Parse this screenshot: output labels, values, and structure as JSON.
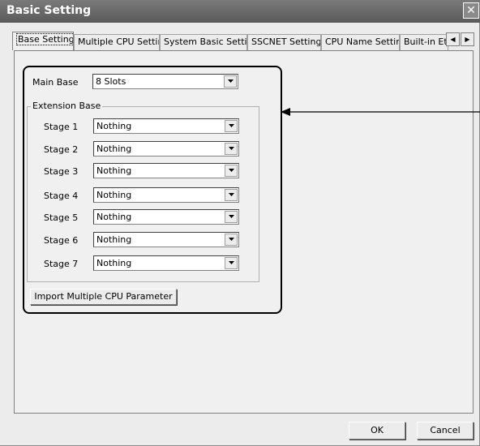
{
  "window": {
    "title": "Basic Setting"
  },
  "tabs": [
    {
      "label": "Base Setting"
    },
    {
      "label": "Multiple CPU Setting"
    },
    {
      "label": "System Basic Setting"
    },
    {
      "label": "SSCNET Setting"
    },
    {
      "label": "CPU Name Setting"
    },
    {
      "label": "Built-in Eth"
    }
  ],
  "main_base": {
    "label": "Main Base",
    "value": "8 Slots"
  },
  "extension_base": {
    "legend": "Extension Base",
    "stages": [
      {
        "label": "Stage 1",
        "value": "Nothing"
      },
      {
        "label": "Stage 2",
        "value": "Nothing"
      },
      {
        "label": "Stage 3",
        "value": "Nothing"
      },
      {
        "label": "Stage 4",
        "value": "Nothing"
      },
      {
        "label": "Stage 5",
        "value": "Nothing"
      },
      {
        "label": "Stage 6",
        "value": "Nothing"
      },
      {
        "label": "Stage 7",
        "value": "Nothing"
      }
    ]
  },
  "buttons": {
    "import": "Import Multiple CPU Parameter",
    "ok": "OK",
    "cancel": "Cancel"
  }
}
